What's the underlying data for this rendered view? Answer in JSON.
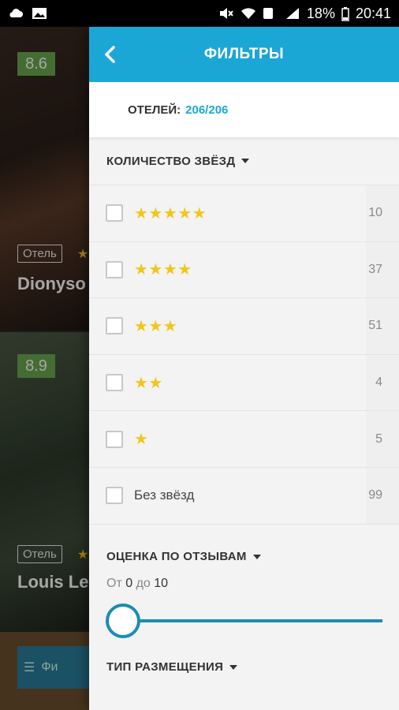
{
  "status_bar": {
    "battery": "18%",
    "time": "20:41"
  },
  "background_list": {
    "hotels": [
      {
        "score": "8.6",
        "type": "Отель",
        "name": "Dionyso"
      },
      {
        "score": "8.9",
        "type": "Отель",
        "name": "Louis Le"
      }
    ],
    "bottom_label": "Фи"
  },
  "header": {
    "title": "ФИЛЬТРЫ"
  },
  "hotels_count": {
    "label": "ОТЕЛЕЙ:",
    "value": "206/206"
  },
  "stars_section": {
    "title": "КОЛИЧЕСТВО ЗВЁЗД",
    "rows": [
      {
        "stars": "★★★★★",
        "count": "10"
      },
      {
        "stars": "★★★★",
        "count": "37"
      },
      {
        "stars": "★★★",
        "count": "51"
      },
      {
        "stars": "★★",
        "count": "4"
      },
      {
        "stars": "★",
        "count": "5"
      }
    ],
    "no_stars": {
      "label": "Без звёзд",
      "count": "99"
    }
  },
  "rating_section": {
    "title": "ОЦЕНКА ПО ОТЗЫВАМ",
    "from_label": "От",
    "from_value": "0",
    "to_label": "до",
    "to_value": "10",
    "slider_value": 0
  },
  "accommodation_section": {
    "title": "ТИП РАЗМЕЩЕНИЯ"
  },
  "colors": {
    "accent": "#1aa7d6",
    "slider": "#1b8db2",
    "star": "#f5c518",
    "score_badge": "#6aa84f"
  }
}
